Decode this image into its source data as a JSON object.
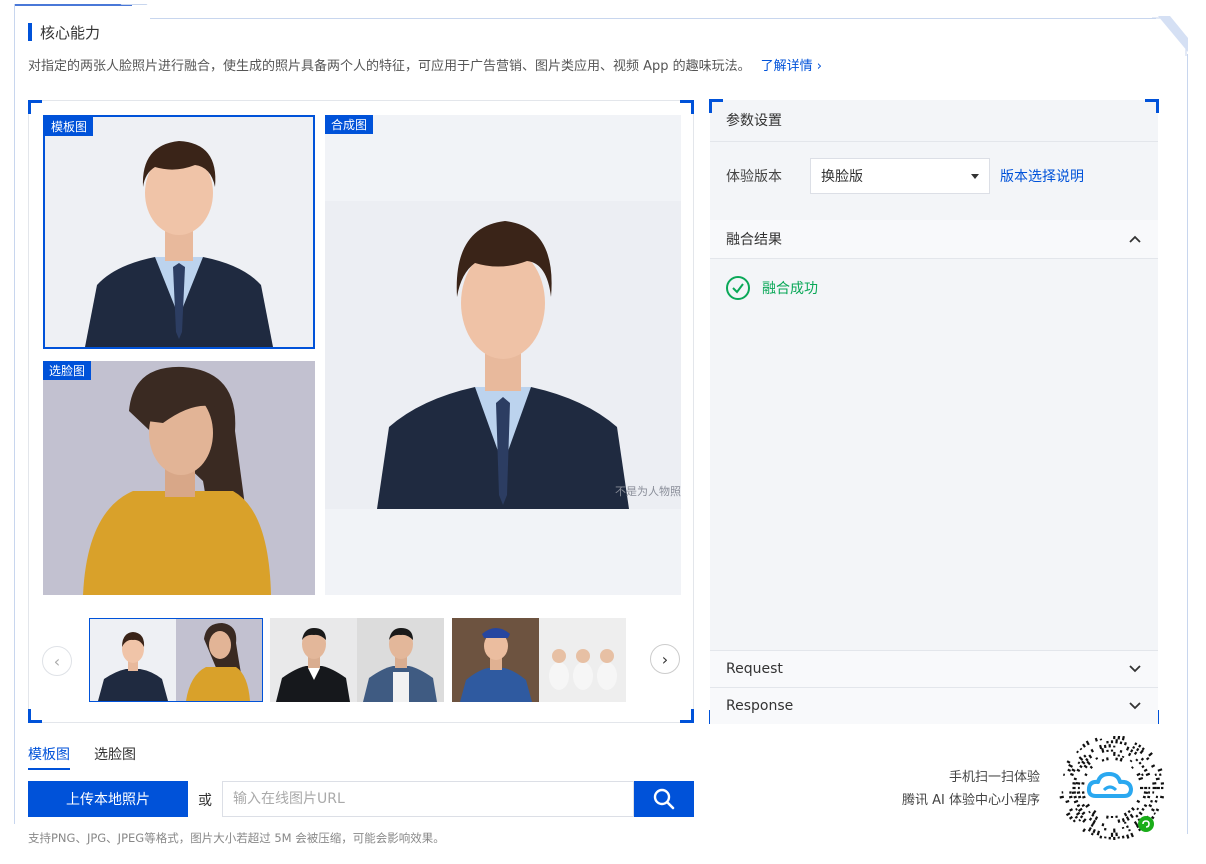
{
  "section": {
    "title": "核心能力",
    "description": "对指定的两张人脸照片进行融合，使生成的照片具备两个人的特征，可应用于广告营销、图片类应用、视频 App 的趣味玩法。",
    "more_link": "了解详情 ›"
  },
  "images": {
    "template_tag": "模板图",
    "face_tag": "选脸图",
    "result_tag": "合成图",
    "result_watermark": "不是为人物照片"
  },
  "carousel": {
    "prev": "‹",
    "next": "›"
  },
  "tabs": [
    {
      "label": "模板图",
      "active": true
    },
    {
      "label": "选脸图",
      "active": false
    }
  ],
  "upload": {
    "button_label": "上传本地照片",
    "or_label": "或",
    "url_placeholder": "输入在线图片URL",
    "hint": "支持PNG、JPG、JPEG等格式，图片大小若超过 5M 会被压缩，可能会影响效果。"
  },
  "params": {
    "header": "参数设置",
    "version_label": "体验版本",
    "version_value": "换脸版",
    "version_link": "版本选择说明",
    "result_header": "融合结果",
    "result_status": "融合成功",
    "request_label": "Request",
    "response_label": "Response"
  },
  "qr": {
    "line1": "手机扫一扫体验",
    "line2": "腾讯 AI 体验中心小程序"
  },
  "colors": {
    "accent": "#0052d9",
    "success": "#0aa858"
  }
}
